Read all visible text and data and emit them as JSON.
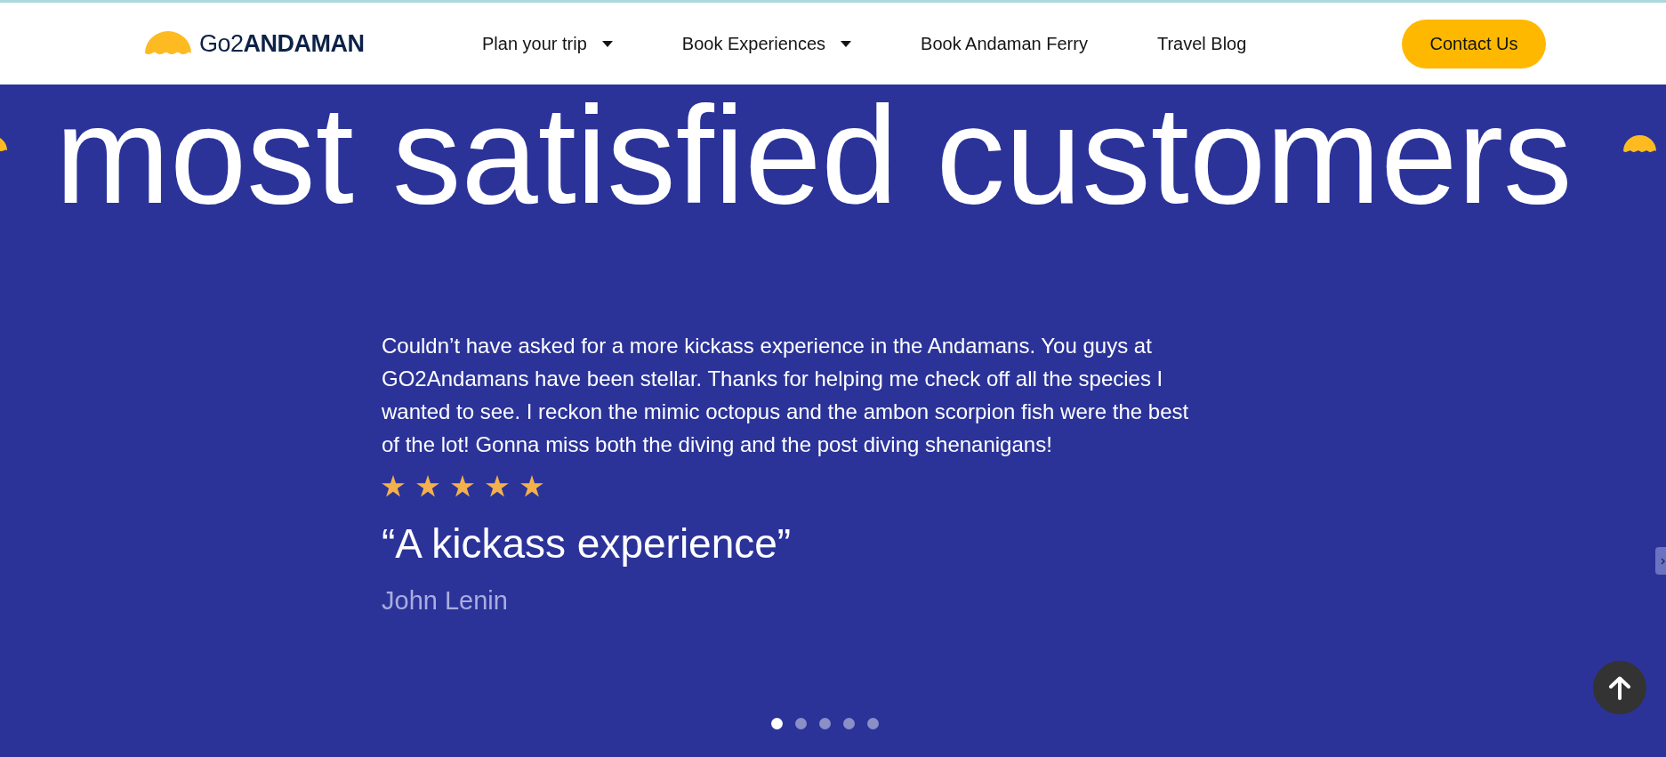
{
  "header": {
    "logo": "Go2**ANDAMAN**",
    "nav": [
      {
        "label": "Plan your trip",
        "dropdown": true
      },
      {
        "label": "Book Experiences",
        "dropdown": true
      },
      {
        "label": "Book Andaman Ferry",
        "dropdown": false
      },
      {
        "label": "Travel Blog",
        "dropdown": false
      }
    ],
    "contact_button": "Contact Us"
  },
  "banner": {
    "heading": "most satisfied customers"
  },
  "testimonial": {
    "quote": "Couldn’t have asked for a more kickass experience in the Andamans. You guys at GO2Andamans have been stellar. Thanks for helping me check off all the species I wanted to see. I reckon the mimic octopus and the ambon scorpion fish were the best of the lot! Gonna miss both the diving and the post diving shenanigans!",
    "stars": 5,
    "title": "“A kickass experience”",
    "author": "John Lenin"
  },
  "carousel_dots": [
    {
      "selected": true
    },
    {
      "selected": false
    },
    {
      "selected": false
    },
    {
      "selected": false
    },
    {
      "selected": false
    }
  ]
}
